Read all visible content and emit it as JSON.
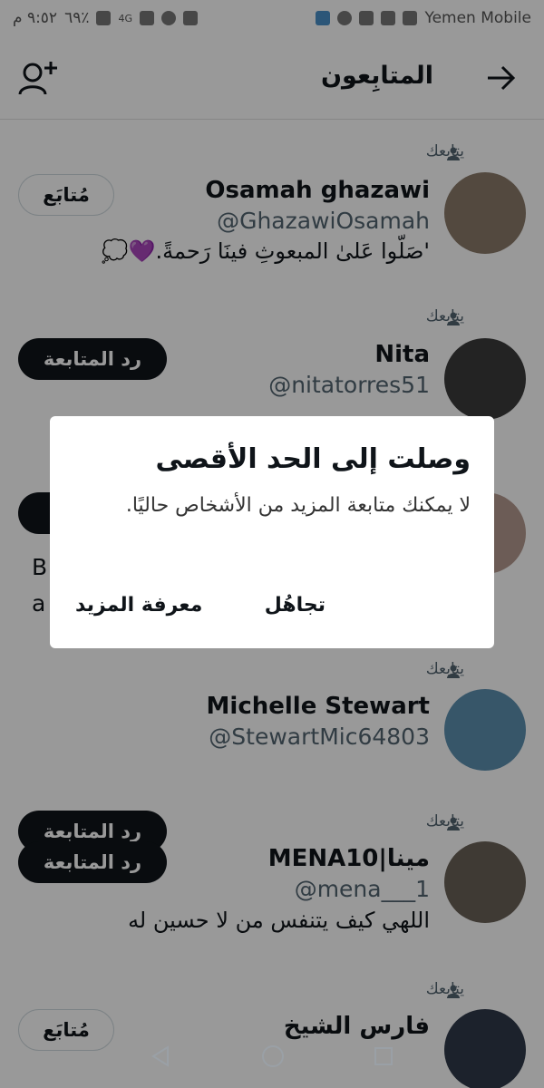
{
  "status_bar": {
    "time": "٩:٥٢ م",
    "battery": "٦٩٪",
    "network": "4G",
    "carrier": "Yemen Mobile"
  },
  "header": {
    "title": "المتابِعون",
    "back_icon": "arrow-right-icon",
    "add_icon": "add-user-icon"
  },
  "follows_you_label": "يتابعك",
  "users": [
    {
      "name": "Osamah ghazawi",
      "handle": "@GhazawiOsamah",
      "bio": "'صَلّوا عَلىٰ المبعوثِ فينَا رَحمةً.💜💭",
      "button": "مُتابَع",
      "button_style": "outline"
    },
    {
      "name": "Nita",
      "handle": "@nitatorres51",
      "bio": "",
      "button": "رد المتابعة",
      "button_style": "dark"
    },
    {
      "name": "",
      "handle": "",
      "bio": "B",
      "bio2": "a",
      "button": "",
      "button_style": "dark"
    },
    {
      "name": "Michelle Stewart",
      "handle": "@StewartMic64803",
      "bio": "",
      "button": "رد المتابعة",
      "button_style": "dark"
    },
    {
      "name": "MENA10|مينا",
      "handle": "@mena___1",
      "bio": "اللهي كيف يتنفس من لا حسين له",
      "button": "رد المتابعة",
      "button_style": "dark"
    },
    {
      "name": "فارس الشيخ",
      "handle": "",
      "bio": "",
      "button": "مُتابَع",
      "button_style": "outline"
    }
  ],
  "dialog": {
    "title": "وصلت إلى الحد الأقصى",
    "body": "لا يمكنك متابعة المزيد من الأشخاص حاليًا.",
    "dismiss": "تجاهُل",
    "learn_more": "معرفة المزيد"
  },
  "nav": {
    "back": "triangle-back-icon",
    "home": "circle-home-icon",
    "recents": "square-recents-icon"
  }
}
